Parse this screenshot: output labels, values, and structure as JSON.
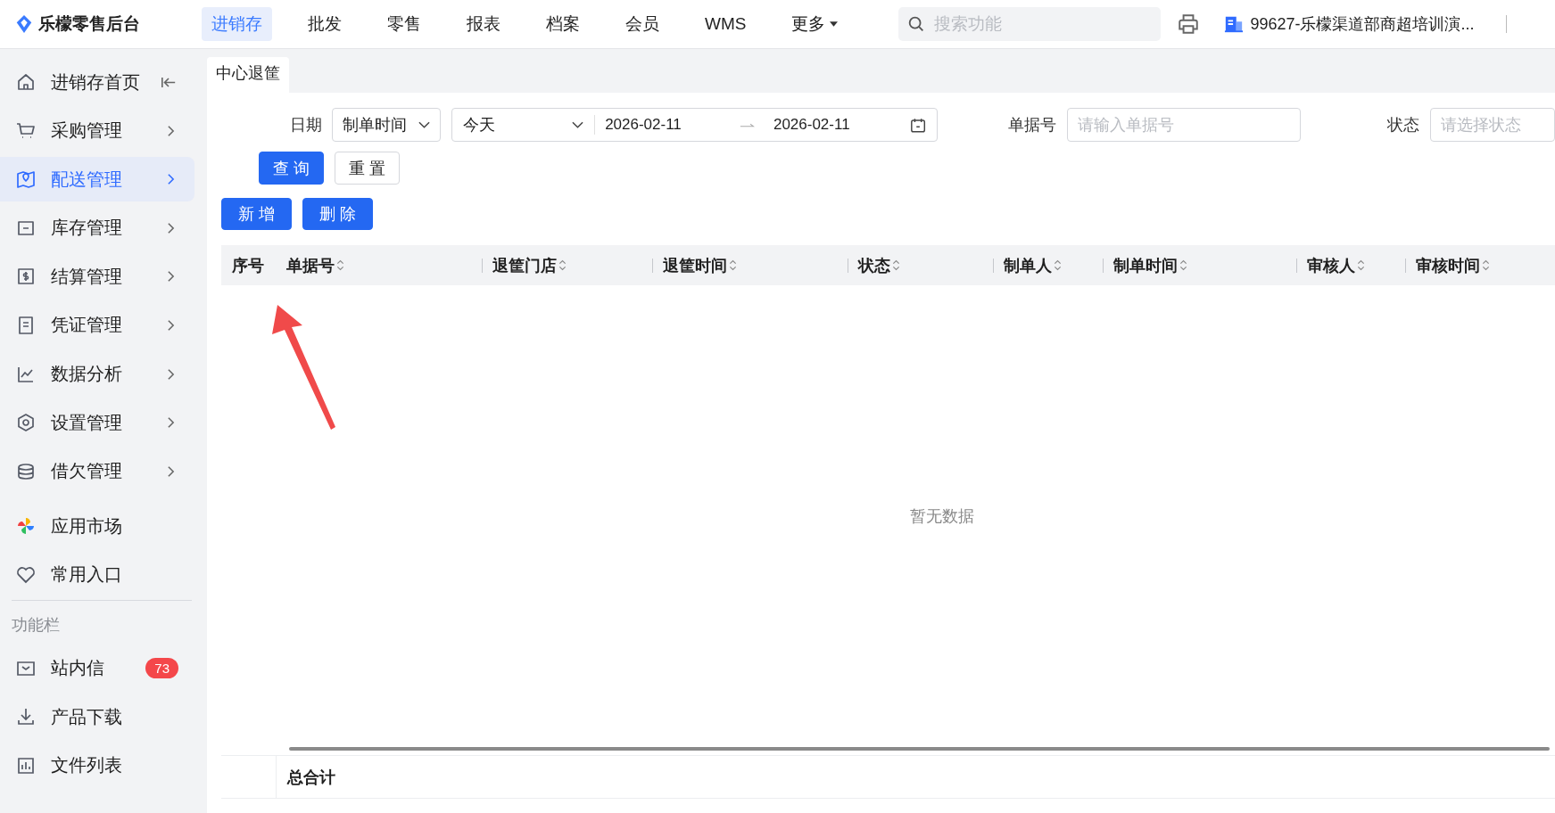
{
  "header": {
    "logo_text": "乐檬零售后台",
    "search": {
      "placeholder": "搜索功能"
    },
    "store_name": "99627-乐檬渠道部商超培训演..."
  },
  "top_nav": [
    {
      "label": "进销存",
      "selected": true,
      "kind": "link"
    },
    {
      "label": "批发",
      "selected": false,
      "kind": "link"
    },
    {
      "label": "零售",
      "selected": false,
      "kind": "link"
    },
    {
      "label": "报表",
      "selected": false,
      "kind": "link"
    },
    {
      "label": "档案",
      "selected": false,
      "kind": "link"
    },
    {
      "label": "会员",
      "selected": false,
      "kind": "link"
    },
    {
      "label": "WMS",
      "selected": false,
      "kind": "link"
    },
    {
      "label": "更多",
      "selected": false,
      "kind": "dropdown"
    }
  ],
  "sidebar": {
    "items": [
      {
        "label": "进销存首页",
        "selected": false,
        "kind": "collapse"
      },
      {
        "label": "采购管理",
        "selected": false,
        "kind": "submenu"
      },
      {
        "label": "配送管理",
        "selected": true,
        "kind": "submenu"
      },
      {
        "label": "库存管理",
        "selected": false,
        "kind": "submenu"
      },
      {
        "label": "结算管理",
        "selected": false,
        "kind": "submenu"
      },
      {
        "label": "凭证管理",
        "selected": false,
        "kind": "submenu"
      },
      {
        "label": "数据分析",
        "selected": false,
        "kind": "submenu"
      },
      {
        "label": "设置管理",
        "selected": false,
        "kind": "submenu"
      },
      {
        "label": "借欠管理",
        "selected": false,
        "kind": "submenu"
      }
    ],
    "extra_items": [
      {
        "label": "应用市场"
      },
      {
        "label": "常用入口"
      }
    ],
    "section_label": "功能栏",
    "tool_items": [
      {
        "label": "站内信",
        "badge": "73"
      },
      {
        "label": "产品下载"
      },
      {
        "label": "文件列表"
      }
    ]
  },
  "tabs": [
    {
      "label": "中心退筐",
      "selected": true
    }
  ],
  "filters": {
    "date": {
      "label": "日期",
      "field": "制单时间",
      "range": "今天",
      "start": "2026-02-11",
      "end": "2026-02-11"
    },
    "bill": {
      "label": "单据号",
      "placeholder": "请输入单据号"
    },
    "status": {
      "label": "状态",
      "placeholder": "请选择状态"
    },
    "buttons": [
      {
        "label": "查 询",
        "kind": "primary"
      },
      {
        "label": "重 置",
        "kind": "default"
      }
    ]
  },
  "actions": [
    {
      "label": "新 增"
    },
    {
      "label": "删 除"
    }
  ],
  "table": {
    "columns": [
      {
        "label": "序号",
        "sortable": false
      },
      {
        "label": "单据号",
        "sortable": true
      },
      {
        "label": "退筐门店",
        "sortable": true
      },
      {
        "label": "退筐时间",
        "sortable": true
      },
      {
        "label": "状态",
        "sortable": true
      },
      {
        "label": "制单人",
        "sortable": true
      },
      {
        "label": "制单时间",
        "sortable": true
      },
      {
        "label": "审核人",
        "sortable": true
      },
      {
        "label": "审核时间",
        "sortable": true
      }
    ],
    "empty_text": "暂无数据",
    "footer_label": "总合计"
  }
}
